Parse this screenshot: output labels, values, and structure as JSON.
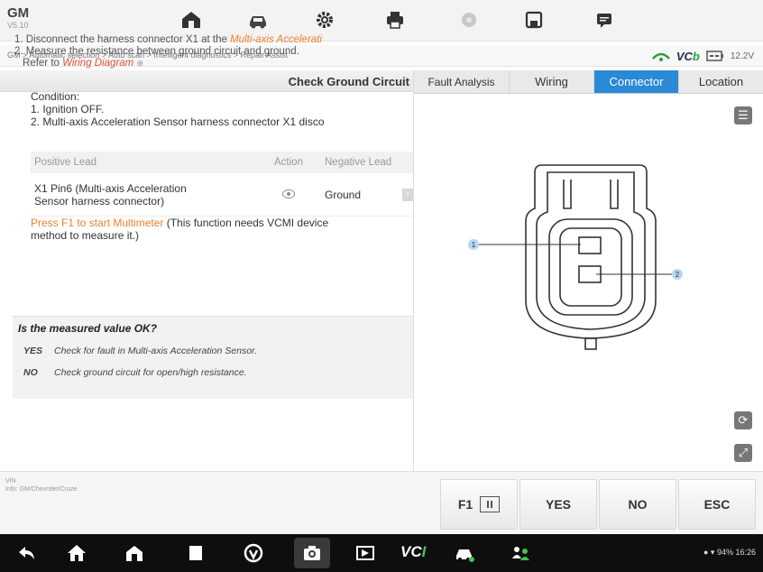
{
  "app": {
    "make": "GM",
    "version": "V5.10"
  },
  "toolbar": {
    "buttons": [
      "home-icon",
      "vehicle-icon",
      "settings-icon",
      "print-icon",
      "help-icon",
      "save-icon",
      "message-icon"
    ]
  },
  "breadcrumb": "GM > Automatic selection > Auto scan > Intelligent diagnostics > Repair Assist",
  "vci": {
    "label_a": "VC",
    "label_b": "b",
    "voltage": "12.2V"
  },
  "left": {
    "title": "Check Ground Circuit",
    "step1_prefix": "1. Disconnect the harness connector X1 at the ",
    "step1_link": "Multi-axis Accelerati",
    "step2_line1": "2. Measure the resistance between ground circuit and ground.",
    "step2_line2_prefix": "Refer to ",
    "step2_link": "Wiring Diagram",
    "condition_label": "Condition:",
    "condition_1": "1. Ignition OFF.",
    "condition_2": "2. Multi-axis Acceleration Sensor harness connector X1 disco",
    "table": {
      "headers": [
        "Positive Lead",
        "Action",
        "Negative Lead"
      ],
      "row_positive_1": "X1 Pin6 (Multi-axis Acceleration",
      "row_positive_2": "Sensor harness connector)",
      "row_negative": "Ground"
    },
    "f1_orange": "Press F1 to start Multimeter",
    "f1_rest": " (This function needs VCMI device",
    "f1_line2": "method to measure it.)",
    "question": "Is the measured value OK?",
    "yes_key": "YES",
    "yes_text": "Check for fault in Multi-axis Acceleration Sensor.",
    "no_key": "NO",
    "no_text": "Check ground circuit for open/high resistance."
  },
  "right": {
    "tabs": [
      "Fault Analysis",
      "Wiring",
      "Connector",
      "Location"
    ],
    "active_tab": "Connector",
    "pin_labels": [
      "1",
      "2"
    ]
  },
  "funcbar": {
    "vin_label": "VIN",
    "vin_info": "Info: GM/Chevrolet/Cruze",
    "buttons": [
      "F1",
      "YES",
      "NO",
      "ESC"
    ]
  },
  "navbar": {
    "vci_a": "VC",
    "vci_b": "I",
    "status": "94% 16:26"
  }
}
